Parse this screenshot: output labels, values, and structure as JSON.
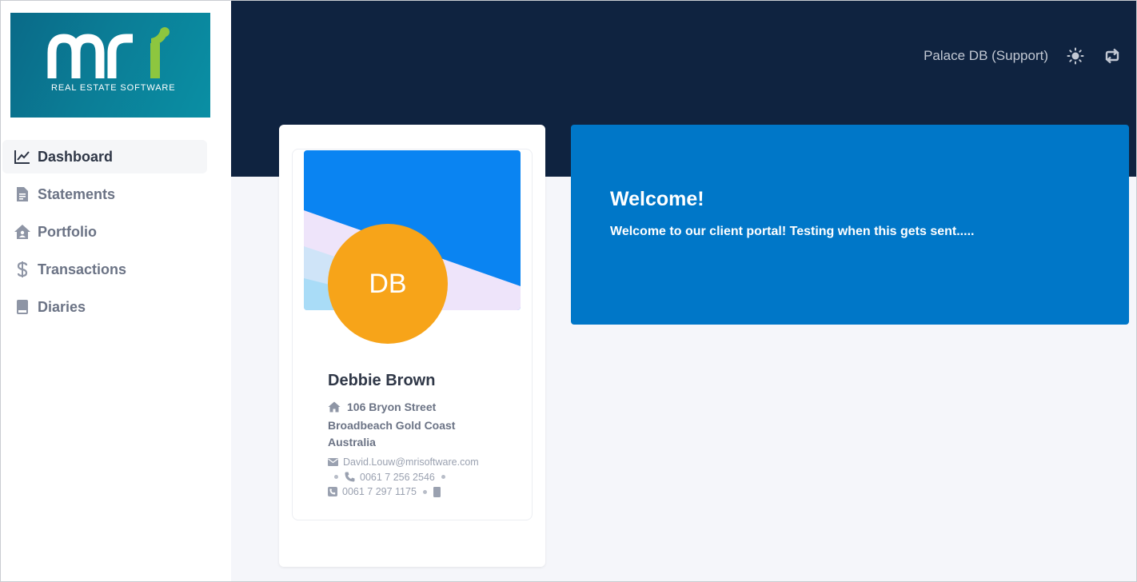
{
  "brand": {
    "logo_letters": "mri",
    "logo_tagline": "REAL ESTATE SOFTWARE",
    "logo_bg": "#0b7d96",
    "logo_accent": "#8dc63f"
  },
  "sidebar": {
    "items": [
      {
        "label": "Dashboard",
        "icon": "chart-line-icon",
        "active": true
      },
      {
        "label": "Statements",
        "icon": "document-icon",
        "active": false
      },
      {
        "label": "Portfolio",
        "icon": "home-icon",
        "active": false
      },
      {
        "label": "Transactions",
        "icon": "dollar-icon",
        "active": false
      },
      {
        "label": "Diaries",
        "icon": "book-icon",
        "active": false
      }
    ]
  },
  "header": {
    "database_label": "Palace DB (Support)",
    "theme_icon": "sun-icon",
    "switch_icon": "switch-icon",
    "band_color": "#0f2340"
  },
  "profile": {
    "initials": "DB",
    "name": "Debbie Brown",
    "address_line1": "106 Bryon Street",
    "address_line2": "Broadbeach Gold Coast",
    "address_line3": "Australia",
    "email": "David.Louw@mrisoftware.com",
    "phone": "0061 7 256 2546",
    "fax": "0061 7 297 1175",
    "avatar_color": "#f7a419"
  },
  "welcome": {
    "title": "Welcome!",
    "message": "Welcome to our client portal! Testing when this gets sent.....",
    "color": "#0077c8"
  }
}
